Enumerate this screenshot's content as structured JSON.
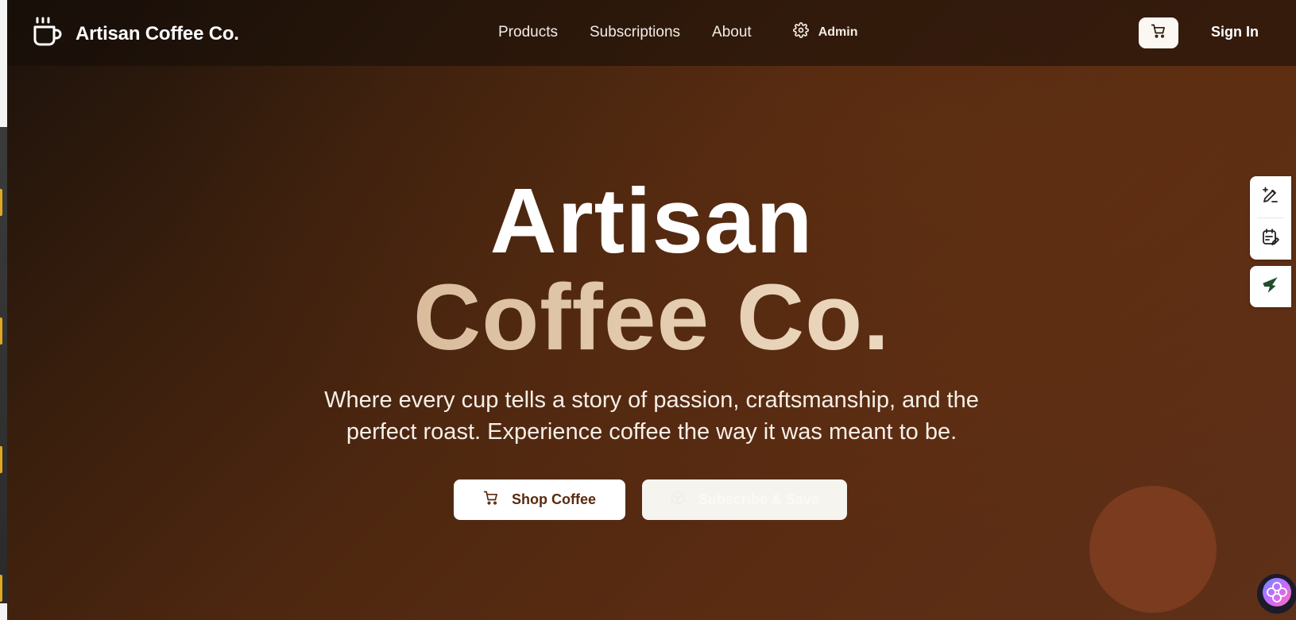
{
  "brand": {
    "name": "Artisan Coffee Co.",
    "logo_icon": "coffee-cup-icon"
  },
  "nav": {
    "items": [
      {
        "label": "Products"
      },
      {
        "label": "Subscriptions"
      },
      {
        "label": "About"
      }
    ],
    "admin_label": "Admin",
    "admin_icon": "gear-icon",
    "cart_icon": "shopping-cart-icon",
    "signin_label": "Sign In"
  },
  "hero": {
    "title_line1": "Artisan",
    "title_line2": "Coffee Co.",
    "tagline_line1": "Where every cup tells a story of passion, craftsmanship, and the",
    "tagline_line2": "perfect roast. Experience coffee the way it was meant to be.",
    "primary_button": "Shop Coffee",
    "primary_icon": "shopping-cart-icon",
    "secondary_button": "Subscribe & Save",
    "secondary_icon": "package-icon"
  },
  "side_tools": {
    "icons": [
      "edit-pen-icon",
      "calendar-edit-icon",
      "leaf-logo-icon"
    ]
  },
  "colors": {
    "brand_dark": "#3a1f0d",
    "brand_brown": "#5a2c12",
    "accent_tan": "#e8d3b8",
    "deco_circle": "#7a3b1f"
  }
}
